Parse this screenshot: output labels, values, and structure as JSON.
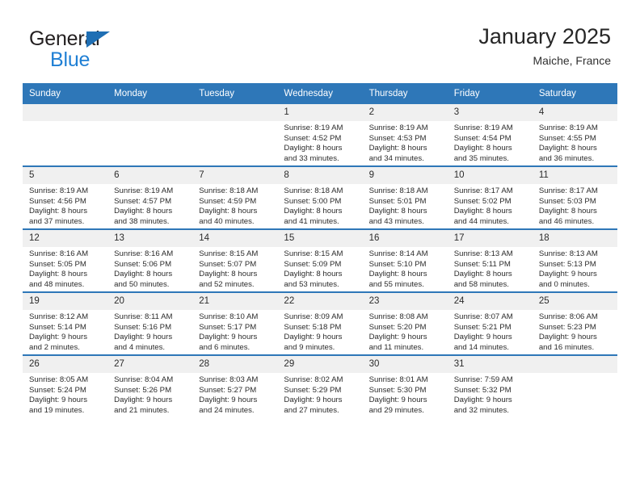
{
  "brand": {
    "name_top": "General",
    "name_bottom": "Blue",
    "logo_icon": "triangle-flag-icon"
  },
  "header": {
    "title": "January 2025",
    "subtitle": "Maiche, France"
  },
  "colors": {
    "header_blue": "#2e77b8",
    "daynum_strip": "#f0f0f0",
    "brand_blue": "#1f7fd4",
    "text": "#2b2b2b"
  },
  "weekday_headers": [
    "Sunday",
    "Monday",
    "Tuesday",
    "Wednesday",
    "Thursday",
    "Friday",
    "Saturday"
  ],
  "weeks": [
    [
      {
        "day": "",
        "empty": true
      },
      {
        "day": "",
        "empty": true
      },
      {
        "day": "",
        "empty": true
      },
      {
        "day": "1",
        "sunrise": "Sunrise: 8:19 AM",
        "sunset": "Sunset: 4:52 PM",
        "daylight1": "Daylight: 8 hours",
        "daylight2": "and 33 minutes."
      },
      {
        "day": "2",
        "sunrise": "Sunrise: 8:19 AM",
        "sunset": "Sunset: 4:53 PM",
        "daylight1": "Daylight: 8 hours",
        "daylight2": "and 34 minutes."
      },
      {
        "day": "3",
        "sunrise": "Sunrise: 8:19 AM",
        "sunset": "Sunset: 4:54 PM",
        "daylight1": "Daylight: 8 hours",
        "daylight2": "and 35 minutes."
      },
      {
        "day": "4",
        "sunrise": "Sunrise: 8:19 AM",
        "sunset": "Sunset: 4:55 PM",
        "daylight1": "Daylight: 8 hours",
        "daylight2": "and 36 minutes."
      }
    ],
    [
      {
        "day": "5",
        "sunrise": "Sunrise: 8:19 AM",
        "sunset": "Sunset: 4:56 PM",
        "daylight1": "Daylight: 8 hours",
        "daylight2": "and 37 minutes."
      },
      {
        "day": "6",
        "sunrise": "Sunrise: 8:19 AM",
        "sunset": "Sunset: 4:57 PM",
        "daylight1": "Daylight: 8 hours",
        "daylight2": "and 38 minutes."
      },
      {
        "day": "7",
        "sunrise": "Sunrise: 8:18 AM",
        "sunset": "Sunset: 4:59 PM",
        "daylight1": "Daylight: 8 hours",
        "daylight2": "and 40 minutes."
      },
      {
        "day": "8",
        "sunrise": "Sunrise: 8:18 AM",
        "sunset": "Sunset: 5:00 PM",
        "daylight1": "Daylight: 8 hours",
        "daylight2": "and 41 minutes."
      },
      {
        "day": "9",
        "sunrise": "Sunrise: 8:18 AM",
        "sunset": "Sunset: 5:01 PM",
        "daylight1": "Daylight: 8 hours",
        "daylight2": "and 43 minutes."
      },
      {
        "day": "10",
        "sunrise": "Sunrise: 8:17 AM",
        "sunset": "Sunset: 5:02 PM",
        "daylight1": "Daylight: 8 hours",
        "daylight2": "and 44 minutes."
      },
      {
        "day": "11",
        "sunrise": "Sunrise: 8:17 AM",
        "sunset": "Sunset: 5:03 PM",
        "daylight1": "Daylight: 8 hours",
        "daylight2": "and 46 minutes."
      }
    ],
    [
      {
        "day": "12",
        "sunrise": "Sunrise: 8:16 AM",
        "sunset": "Sunset: 5:05 PM",
        "daylight1": "Daylight: 8 hours",
        "daylight2": "and 48 minutes."
      },
      {
        "day": "13",
        "sunrise": "Sunrise: 8:16 AM",
        "sunset": "Sunset: 5:06 PM",
        "daylight1": "Daylight: 8 hours",
        "daylight2": "and 50 minutes."
      },
      {
        "day": "14",
        "sunrise": "Sunrise: 8:15 AM",
        "sunset": "Sunset: 5:07 PM",
        "daylight1": "Daylight: 8 hours",
        "daylight2": "and 52 minutes."
      },
      {
        "day": "15",
        "sunrise": "Sunrise: 8:15 AM",
        "sunset": "Sunset: 5:09 PM",
        "daylight1": "Daylight: 8 hours",
        "daylight2": "and 53 minutes."
      },
      {
        "day": "16",
        "sunrise": "Sunrise: 8:14 AM",
        "sunset": "Sunset: 5:10 PM",
        "daylight1": "Daylight: 8 hours",
        "daylight2": "and 55 minutes."
      },
      {
        "day": "17",
        "sunrise": "Sunrise: 8:13 AM",
        "sunset": "Sunset: 5:11 PM",
        "daylight1": "Daylight: 8 hours",
        "daylight2": "and 58 minutes."
      },
      {
        "day": "18",
        "sunrise": "Sunrise: 8:13 AM",
        "sunset": "Sunset: 5:13 PM",
        "daylight1": "Daylight: 9 hours",
        "daylight2": "and 0 minutes."
      }
    ],
    [
      {
        "day": "19",
        "sunrise": "Sunrise: 8:12 AM",
        "sunset": "Sunset: 5:14 PM",
        "daylight1": "Daylight: 9 hours",
        "daylight2": "and 2 minutes."
      },
      {
        "day": "20",
        "sunrise": "Sunrise: 8:11 AM",
        "sunset": "Sunset: 5:16 PM",
        "daylight1": "Daylight: 9 hours",
        "daylight2": "and 4 minutes."
      },
      {
        "day": "21",
        "sunrise": "Sunrise: 8:10 AM",
        "sunset": "Sunset: 5:17 PM",
        "daylight1": "Daylight: 9 hours",
        "daylight2": "and 6 minutes."
      },
      {
        "day": "22",
        "sunrise": "Sunrise: 8:09 AM",
        "sunset": "Sunset: 5:18 PM",
        "daylight1": "Daylight: 9 hours",
        "daylight2": "and 9 minutes."
      },
      {
        "day": "23",
        "sunrise": "Sunrise: 8:08 AM",
        "sunset": "Sunset: 5:20 PM",
        "daylight1": "Daylight: 9 hours",
        "daylight2": "and 11 minutes."
      },
      {
        "day": "24",
        "sunrise": "Sunrise: 8:07 AM",
        "sunset": "Sunset: 5:21 PM",
        "daylight1": "Daylight: 9 hours",
        "daylight2": "and 14 minutes."
      },
      {
        "day": "25",
        "sunrise": "Sunrise: 8:06 AM",
        "sunset": "Sunset: 5:23 PM",
        "daylight1": "Daylight: 9 hours",
        "daylight2": "and 16 minutes."
      }
    ],
    [
      {
        "day": "26",
        "sunrise": "Sunrise: 8:05 AM",
        "sunset": "Sunset: 5:24 PM",
        "daylight1": "Daylight: 9 hours",
        "daylight2": "and 19 minutes."
      },
      {
        "day": "27",
        "sunrise": "Sunrise: 8:04 AM",
        "sunset": "Sunset: 5:26 PM",
        "daylight1": "Daylight: 9 hours",
        "daylight2": "and 21 minutes."
      },
      {
        "day": "28",
        "sunrise": "Sunrise: 8:03 AM",
        "sunset": "Sunset: 5:27 PM",
        "daylight1": "Daylight: 9 hours",
        "daylight2": "and 24 minutes."
      },
      {
        "day": "29",
        "sunrise": "Sunrise: 8:02 AM",
        "sunset": "Sunset: 5:29 PM",
        "daylight1": "Daylight: 9 hours",
        "daylight2": "and 27 minutes."
      },
      {
        "day": "30",
        "sunrise": "Sunrise: 8:01 AM",
        "sunset": "Sunset: 5:30 PM",
        "daylight1": "Daylight: 9 hours",
        "daylight2": "and 29 minutes."
      },
      {
        "day": "31",
        "sunrise": "Sunrise: 7:59 AM",
        "sunset": "Sunset: 5:32 PM",
        "daylight1": "Daylight: 9 hours",
        "daylight2": "and 32 minutes."
      },
      {
        "day": "",
        "empty": true
      }
    ]
  ]
}
